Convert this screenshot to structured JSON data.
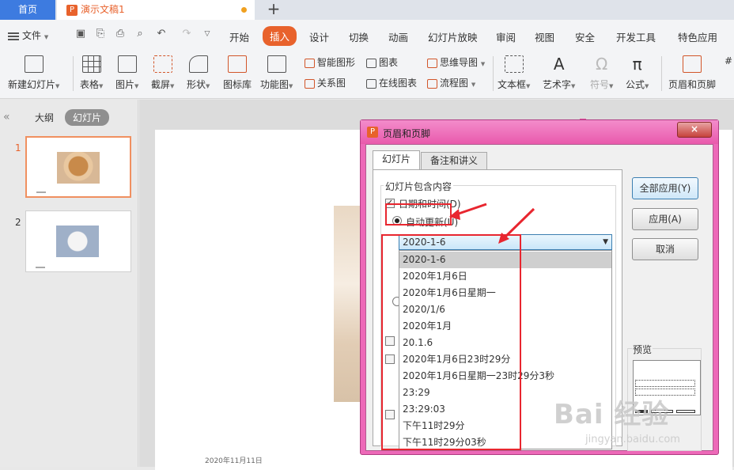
{
  "tabs": {
    "home": "首页",
    "doc_title": "演示文稿1",
    "new_tab": "+"
  },
  "menu": {
    "file": "文件",
    "tabs": [
      "开始",
      "插入",
      "设计",
      "切换",
      "动画",
      "幻灯片放映",
      "审阅",
      "视图",
      "安全",
      "开发工具",
      "特色应用"
    ],
    "active": "插入"
  },
  "ribbon": {
    "new_slide": "新建幻灯片",
    "table": "表格",
    "picture": "图片",
    "screenshot": "截屏",
    "shape": "形状",
    "icon_lib": "图标库",
    "func_chart": "功能图",
    "smart_art": "智能图形",
    "relation": "关系图",
    "chart": "图表",
    "online_chart": "在线图表",
    "mind_map": "思维导图",
    "flow_chart": "流程图",
    "textbox": "文本框",
    "art_text": "艺术字",
    "symbol": "符号",
    "formula": "公式",
    "header_footer": "页眉和页脚",
    "more": "#"
  },
  "left_panel": {
    "outline": "大纲",
    "slides": "幻灯片",
    "slide_numbers": [
      "1",
      "2"
    ]
  },
  "slide": {
    "date_text": "2020年11月11日"
  },
  "dialog": {
    "title": "页眉和页脚",
    "close": "×",
    "tab_slide": "幻灯片",
    "tab_notes": "备注和讲义",
    "group_label": "幻灯片包含内容",
    "date_time_label": "日期和时间(D)",
    "auto_update_label": "自动更新(U)",
    "combo_value": "2020-1-6",
    "date_formats": [
      "2020-1-6",
      "2020年1月6日",
      "2020年1月6日星期一",
      "2020/1/6",
      "2020年1月",
      "20.1.6",
      "2020年1月6日23时29分",
      "2020年1月6日星期一23时29分3秒",
      "23:29",
      "23:29:03",
      "下午11时29分",
      "下午11时29分03秒"
    ],
    "btn_apply_all": "全部应用(Y)",
    "btn_apply": "应用(A)",
    "btn_cancel": "取消",
    "preview_label": "预览"
  },
  "watermark": {
    "brand": "Bai 经验",
    "url": "jingyan.baidu.com"
  },
  "colors": {
    "accent": "#e8622c",
    "dialog_frame": "#ed69b8",
    "annotation": "#e8262f",
    "home_tab": "#3d7be0"
  }
}
